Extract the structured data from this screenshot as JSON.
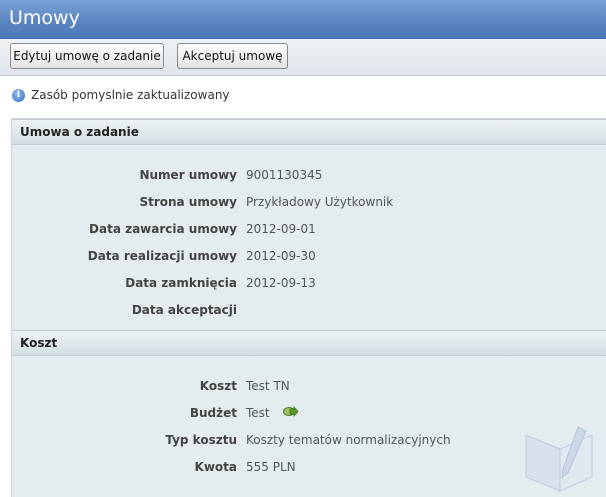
{
  "header": {
    "title": "Umowy"
  },
  "toolbar": {
    "edit_label": "Edytuj umowę o zadanie",
    "accept_label": "Akceptuj umowę"
  },
  "message": {
    "text": "Zasób pomyslnie zaktualizowany",
    "icon": "info-icon"
  },
  "contract_section": {
    "title": "Umowa o zadanie",
    "fields": [
      {
        "label": "Numer umowy",
        "value": "9001130345"
      },
      {
        "label": "Strona umowy",
        "value": "Przykładowy Użytkownik"
      },
      {
        "label": "Data zawarcia umowy",
        "value": "2012-09-01"
      },
      {
        "label": "Data realizacji umowy",
        "value": "2012-09-30"
      },
      {
        "label": "Data zamknięcia",
        "value": "2012-09-13"
      },
      {
        "label": "Data akceptacji",
        "value": ""
      }
    ]
  },
  "cost_section": {
    "title": "Koszt",
    "fields": [
      {
        "label": "Koszt",
        "value": "Test TN"
      },
      {
        "label": "Budżet",
        "value": "Test",
        "icon": "link-arrow-icon"
      },
      {
        "label": "Typ kosztu",
        "value": "Koszty tematów normalizacyjnych"
      },
      {
        "label": "Kwota",
        "value": "555 PLN"
      }
    ]
  },
  "colors": {
    "titlebar": "#5b86c2",
    "panel_bg": "#e4ecef",
    "info_icon": "#3b74c4",
    "budget_icon": "#5a9a2a"
  }
}
